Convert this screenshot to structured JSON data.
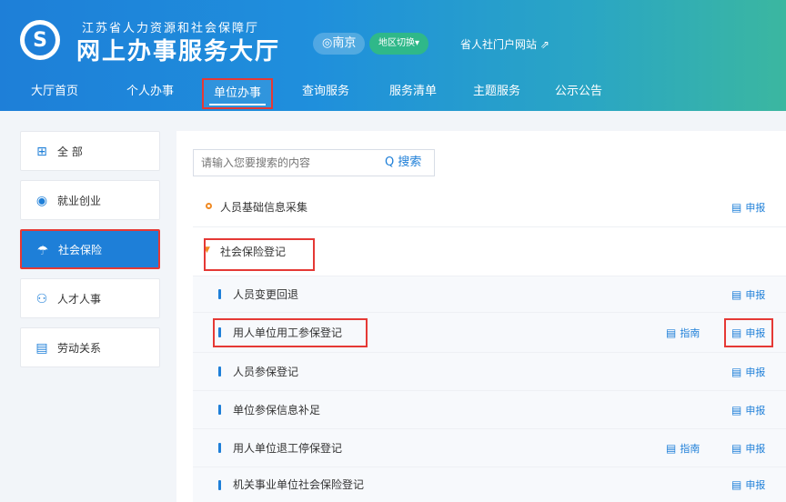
{
  "header": {
    "org_name": "江苏省人力资源和社会保障厅",
    "hall_title": "网上办事服务大厅",
    "city": "◎南京",
    "city_switch": "地区切换▾",
    "portal_link": "省人社门户网站 ⇗"
  },
  "nav": [
    {
      "label": "大厅首页"
    },
    {
      "label": "个人办事"
    },
    {
      "label": "单位办事"
    },
    {
      "label": "查询服务"
    },
    {
      "label": "服务清单"
    },
    {
      "label": "主题服务"
    },
    {
      "label": "公示公告"
    }
  ],
  "sidebar": [
    {
      "label": "全 部",
      "icon": "grid-icon"
    },
    {
      "label": "就业创业",
      "icon": "employment-icon"
    },
    {
      "label": "社会保险",
      "icon": "umbrella-icon"
    },
    {
      "label": "人才人事",
      "icon": "people-icon"
    },
    {
      "label": "劳动关系",
      "icon": "document-icon"
    }
  ],
  "search": {
    "placeholder": "请输入您要搜索的内容",
    "button": "搜索"
  },
  "items": {
    "top1": {
      "label": "人员基础信息采集",
      "action": "申报"
    },
    "top2": {
      "label": "社会保险登记"
    },
    "sub": [
      {
        "label": "人员变更回退",
        "action": "申报",
        "guide": ""
      },
      {
        "label": "用人单位用工参保登记",
        "action": "申报",
        "guide": "指南"
      },
      {
        "label": "人员参保登记",
        "action": "申报",
        "guide": ""
      },
      {
        "label": "单位参保信息补足",
        "action": "申报",
        "guide": ""
      },
      {
        "label": "用人单位退工停保登记",
        "action": "申报",
        "guide": "指南"
      },
      {
        "label": "机关事业单位社会保险登记",
        "action": "申报",
        "guide": ""
      }
    ]
  },
  "colors": {
    "primary": "#1e7fd8",
    "highlight": "#e53935",
    "accent": "#f08a24"
  }
}
